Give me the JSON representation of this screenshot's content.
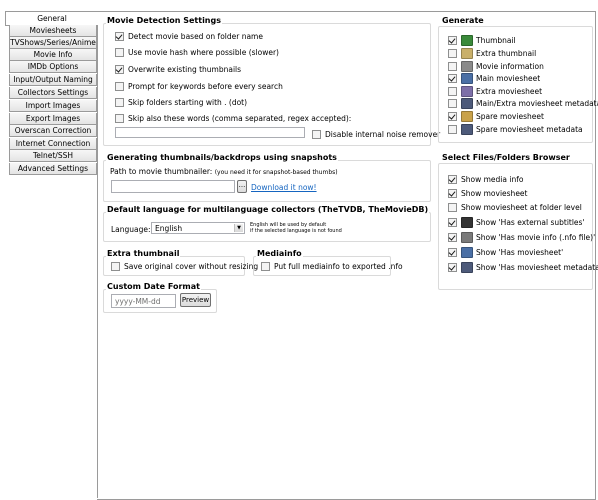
{
  "sidebar": {
    "tabs": [
      "General",
      "Moviesheets",
      "TVShows/Series/Anime",
      "Movie Info",
      "IMDb Options",
      "Input/Output Naming",
      "Collectors Settings",
      "Import Images",
      "Export Images",
      "Overscan Correction",
      "Internet Connection",
      "Telnet/SSH",
      "Advanced Settings"
    ],
    "active": "General"
  },
  "movie_detection": {
    "title": "Movie Detection Settings",
    "items": [
      {
        "label": "Detect movie based on folder name",
        "checked": true
      },
      {
        "label": "Use movie hash where possible (slower)",
        "checked": false
      },
      {
        "label": "Overwrite existing thumbnails",
        "checked": true
      },
      {
        "label": "Prompt for keywords before every search",
        "checked": false
      },
      {
        "label": "Skip folders starting with . (dot)",
        "checked": false
      },
      {
        "label": "Skip also these words (comma separated, regex accepted):",
        "checked": false
      }
    ],
    "words_value": "",
    "disable_noise": {
      "label": "Disable internal noise remover",
      "checked": false
    }
  },
  "snapshots": {
    "title": "Generating thumbnails/backdrops using snapshots",
    "path_label": "Path to movie thumbnailer:",
    "path_hint": "(you need it for snapshot-based thumbs)",
    "path_value": "",
    "browse_label": "...",
    "download_label": "Download it now!"
  },
  "language": {
    "title": "Default language for multilanguage collectors (TheTVDB, TheMovieDB)",
    "label": "Language:",
    "value": "English",
    "note_line1": "English will be used by default",
    "note_line2": "if the selected language is not found"
  },
  "extra_thumbnail": {
    "title": "Extra thumbnail",
    "item": {
      "label": "Save original cover without resizing",
      "checked": false
    }
  },
  "mediainfo": {
    "title": "Mediainfo",
    "item": {
      "label": "Put full mediainfo to exported .nfo",
      "checked": false
    }
  },
  "date_format": {
    "title": "Custom Date Format",
    "placeholder": "yyyy-MM-dd",
    "preview_label": "Preview"
  },
  "generate": {
    "title": "Generate",
    "items": [
      {
        "label": "Thumbnail",
        "checked": true,
        "icon": "thumbnail-icon",
        "color": "#3a8a3a"
      },
      {
        "label": "Extra thumbnail",
        "checked": false,
        "icon": "extra-thumbnail-icon",
        "color": "#c9b06a"
      },
      {
        "label": "Movie information",
        "checked": false,
        "icon": "movie-information-icon",
        "color": "#8a8a8a"
      },
      {
        "label": "Main moviesheet",
        "checked": true,
        "icon": "main-moviesheet-icon",
        "color": "#4a6fa5"
      },
      {
        "label": "Extra moviesheet",
        "checked": false,
        "icon": "extra-moviesheet-icon",
        "color": "#7d6fa8"
      },
      {
        "label": "Main/Extra moviesheet metadata",
        "checked": false,
        "icon": "moviesheet-metadata-icon",
        "color": "#4d5a7a"
      },
      {
        "label": "Spare moviesheet",
        "checked": true,
        "icon": "spare-moviesheet-icon",
        "color": "#c9a24a"
      },
      {
        "label": "Spare moviesheet metadata",
        "checked": false,
        "icon": "spare-metadata-icon",
        "color": "#4d5a7a"
      }
    ]
  },
  "browser": {
    "title": "Select Files/Folders Browser",
    "items": [
      {
        "label": "Show media info",
        "checked": true,
        "icon": null
      },
      {
        "label": "Show moviesheet",
        "checked": true,
        "icon": null
      },
      {
        "label": "Show moviesheet at folder level",
        "checked": false,
        "icon": null
      },
      {
        "label": "Show 'Has external subtitles'",
        "checked": true,
        "icon": "subtitles-icon",
        "color": "#333333"
      },
      {
        "label": "Show 'Has movie info (.nfo file)'",
        "checked": true,
        "icon": "nfo-icon",
        "color": "#7a7a7a"
      },
      {
        "label": "Show 'Has moviesheet'",
        "checked": true,
        "icon": "moviesheet-icon",
        "color": "#4a6fa5"
      },
      {
        "label": "Show 'Has moviesheet metadata'",
        "checked": true,
        "icon": "metadata-icon",
        "color": "#4d5a7a"
      }
    ]
  }
}
